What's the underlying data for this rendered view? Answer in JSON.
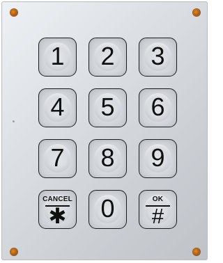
{
  "keypad": {
    "keys": [
      {
        "label": "1"
      },
      {
        "label": "2"
      },
      {
        "label": "3"
      },
      {
        "label": "4"
      },
      {
        "label": "5"
      },
      {
        "label": "6"
      },
      {
        "label": "7"
      },
      {
        "label": "8"
      },
      {
        "label": "9"
      },
      {
        "caption": "CANCEL",
        "symbol": "✱"
      },
      {
        "label": "0"
      },
      {
        "caption": "OK",
        "symbol": "#"
      }
    ]
  }
}
